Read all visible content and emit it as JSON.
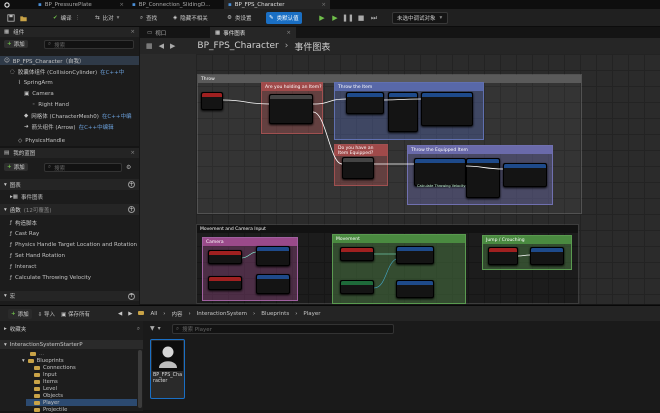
{
  "doc_tabs": [
    {
      "label": "BP_PressurePlate"
    },
    {
      "label": "BP_Connection_SlidingD..."
    },
    {
      "label": "BP_FPS_Character",
      "active": true
    }
  ],
  "toolbar": {
    "compile": "编译",
    "diff": "比对",
    "search": "查找",
    "hide": "隐藏不相关",
    "class_settings": "类设置",
    "class_defaults": "类默认值",
    "debug_select": "未选中调试对象"
  },
  "components": {
    "title": "组件",
    "add": "添加",
    "search_placeholder": "搜索",
    "root": "BP_FPS_Character（自我）",
    "items": [
      {
        "label": "胶囊体组件 (CollisionCylinder)",
        "tag": "在C++中"
      },
      {
        "label": "SpringArm",
        "tag": ""
      },
      {
        "label": "Camera",
        "tag": ""
      },
      {
        "label": "Right Hand",
        "tag": ""
      },
      {
        "label": "网格体 (CharacterMesh0)",
        "tag": "在C++中编"
      },
      {
        "label": "箭头组件 (Arrow)",
        "tag": "在C++中编辑"
      },
      {
        "label": "PhysicsHandle",
        "tag": ""
      }
    ]
  },
  "my_blueprint": {
    "title": "我的蓝图",
    "add": "添加",
    "search_placeholder": "搜索",
    "graphs_title": "图表",
    "event_graph": "事件图表",
    "functions_title": "函数",
    "functions_count": "(12可覆盖)",
    "functions": [
      "构造脚本",
      "Cast Ray",
      "Physics Handle Target Location and Rotation",
      "Set Hand Rotation",
      "Interact",
      "Calculate Throwing Velocity"
    ],
    "macros_title": "宏"
  },
  "editor_tabs": {
    "viewport": "视口",
    "event_graph": "事件图表"
  },
  "breadcrumb": {
    "root": "BP_FPS_Character",
    "current": "事件图表"
  },
  "graph": {
    "comment_throw": "Throw",
    "comment_holding": "Are you holding an Item?",
    "comment_throw_item": "Throw the Item",
    "comment_equipped": "Do you have an Item Equipped?",
    "comment_throw_equipped": "Throw the Equipped Item",
    "comment_movement": "Movement and Camera Input",
    "comment_camera": "Camera",
    "comment_movement_sub": "Movement",
    "comment_jump": "Jump / Crouching",
    "func_label": "Calculate Throwing Velocity"
  },
  "content_browser": {
    "add": "添加",
    "import": "导入",
    "save_all": "保存所有",
    "path": [
      "All",
      "内容",
      "InteractionSystem",
      "Blueprints",
      "Player"
    ],
    "favorites": "收藏夹",
    "search_placeholder": "搜索 Player",
    "project": "InteractionSystemStarterP",
    "folders": [
      "Blueprints",
      "Connections",
      "Input",
      "Items",
      "Level",
      "Objects",
      "Player",
      "Projectile"
    ],
    "folder_partial": "...",
    "asset_name": "BP_FPS_Character"
  },
  "colors": {
    "accent": "#1a6fc4",
    "compile_green": "#6fbf4a",
    "tag_blue": "#6a9ed8",
    "folder": "#c9a347"
  }
}
